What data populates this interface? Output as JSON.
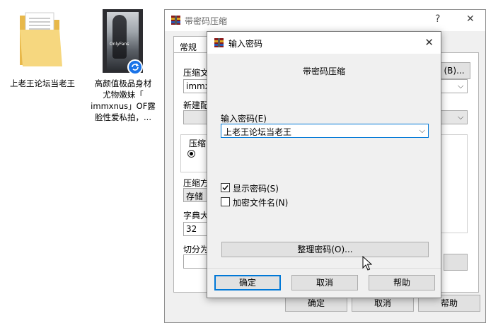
{
  "desktop": {
    "folder_label": "上老王论坛当老王",
    "video_label_lines": [
      "高颜值极品身材",
      "尤物嫩妹「",
      "immxnus」OF露",
      "脸性爱私拍，..."
    ],
    "video_thumb_text": "OnlyFans"
  },
  "bg_window": {
    "title": "带密码压缩",
    "tab": "常规",
    "archive_label": "压缩文",
    "archive_value": "immxnu",
    "browse_button": "(B)...",
    "profile_label": "新建配",
    "format_label": "压缩",
    "method_label": "压缩方",
    "method_value": "存储",
    "dict_label": "字典大",
    "dict_value": "32",
    "split_label": "切分为",
    "ok": "确定",
    "cancel": "取消",
    "help": "帮助",
    "ctrl_help": "?",
    "ctrl_close": "✕"
  },
  "dialog": {
    "title": "输入密码",
    "heading": "带密码压缩",
    "password_label": "输入密码(E)",
    "password_value": "上老王论坛当老王",
    "show_password": "显示密码(S)",
    "show_password_checked": true,
    "encrypt_names": "加密文件名(N)",
    "encrypt_names_checked": false,
    "organize_button": "整理密码(O)...",
    "ok": "确定",
    "cancel": "取消",
    "help": "帮助",
    "close": "✕"
  }
}
